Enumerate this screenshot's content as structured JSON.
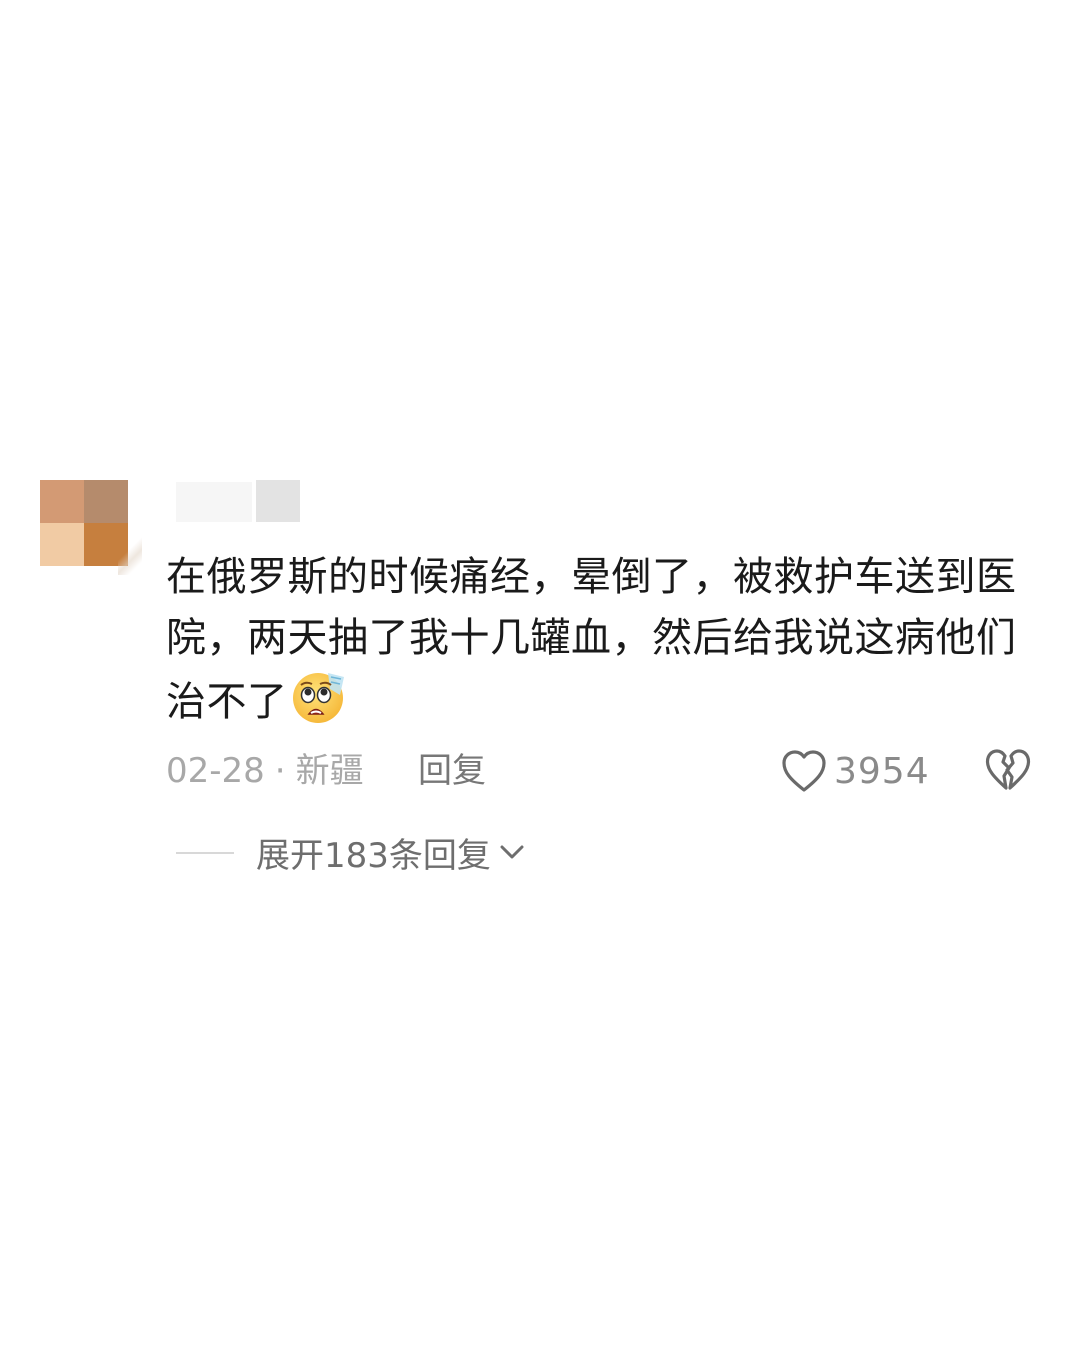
{
  "comment": {
    "text": "在俄罗斯的时候痛经，晕倒了，被救护车送到医院，两天抽了我十几罐血，然后给我说这病他们治不了",
    "emoji": "worried-face-emoji",
    "date": "02-28",
    "separator": "·",
    "location": "新疆",
    "reply_label": "回复",
    "like_count": "3954",
    "expand_label": "展开183条回复"
  },
  "colors": {
    "text_primary": "#1a1a1a",
    "text_meta": "#a8a8a8",
    "text_secondary": "#6e6e6e",
    "background": "#ffffff"
  },
  "icons": {
    "like": "heart-outline-icon",
    "dislike": "broken-heart-icon",
    "expand": "chevron-down-icon"
  }
}
